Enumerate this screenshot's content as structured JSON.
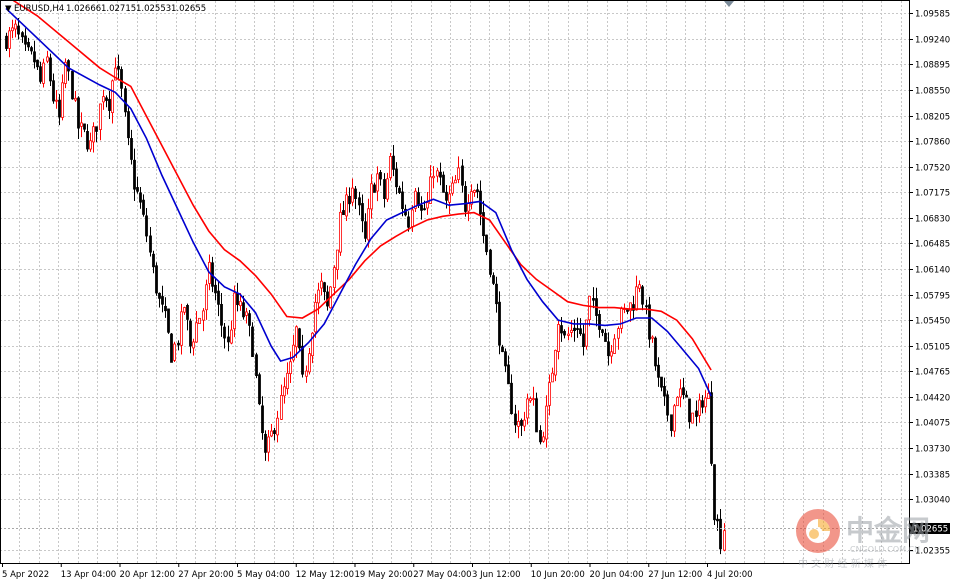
{
  "header": {
    "menu_glyph": "▼",
    "symbol": "EURUSD,H4",
    "open": "1.02666",
    "high": "1.02715",
    "low": "1.02553",
    "close": "1.02655"
  },
  "price_tag": "1.02655",
  "watermark": {
    "title": "中金网",
    "domain": "CNGOLD.COM.CN",
    "subtitle": "中 文 财 经 新 媒 体",
    "logo_colors": [
      "#e8412c",
      "#f7a21b"
    ]
  },
  "colors": {
    "bull": "#ff0000",
    "bear": "#000000",
    "ma_fast": "#0000d0",
    "ma_slow": "#ff0000",
    "grid": "#c8c8c8"
  },
  "chart_data": {
    "type": "candlestick",
    "symbol": "EURUSD",
    "timeframe": "H4",
    "y_ticks": [
      "1.09585",
      "1.09240",
      "1.08895",
      "1.08550",
      "1.08205",
      "1.07860",
      "1.07520",
      "1.07175",
      "1.06830",
      "1.06485",
      "1.06140",
      "1.05795",
      "1.05450",
      "1.05105",
      "1.04765",
      "1.04420",
      "1.04075",
      "1.03730",
      "1.03385",
      "1.03040",
      "1.02355"
    ],
    "x_ticks": [
      "5 Apr 2022",
      "13 Apr 04:00",
      "20 Apr 12:00",
      "27 Apr 20:00",
      "5 May 04:00",
      "12 May 12:00",
      "19 May 20:00",
      "27 May 04:00",
      "3 Jun 12:00",
      "10 Jun 20:00",
      "20 Jun 04:00",
      "27 Jun 12:00",
      "4 Jul 20:00"
    ],
    "ylim": [
      1.0218,
      1.0975
    ],
    "grid": true,
    "close_path": [
      [
        0,
        1.0925
      ],
      [
        3,
        1.0935
      ],
      [
        6,
        1.0905
      ],
      [
        9,
        1.0895
      ],
      [
        11,
        1.0865
      ],
      [
        13,
        1.0895
      ],
      [
        15,
        1.0845
      ],
      [
        17,
        1.0815
      ],
      [
        19,
        1.089
      ],
      [
        21,
        1.0855
      ],
      [
        23,
        1.0805
      ],
      [
        25,
        1.0795
      ],
      [
        27,
        1.078
      ],
      [
        29,
        1.081
      ],
      [
        31,
        1.0855
      ],
      [
        33,
        1.084
      ],
      [
        35,
        1.0895
      ],
      [
        37,
        1.085
      ],
      [
        39,
        1.078
      ],
      [
        41,
        1.073
      ],
      [
        43,
        1.07
      ],
      [
        45,
        1.066
      ],
      [
        47,
        1.061
      ],
      [
        49,
        1.057
      ],
      [
        51,
        1.0545
      ],
      [
        53,
        1.05
      ],
      [
        55,
        1.052
      ],
      [
        57,
        1.0565
      ],
      [
        59,
        1.051
      ],
      [
        61,
        1.054
      ],
      [
        63,
        1.056
      ],
      [
        65,
        1.061
      ],
      [
        67,
        1.058
      ],
      [
        69,
        1.054
      ],
      [
        71,
        1.051
      ],
      [
        73,
        1.057
      ],
      [
        75,
        1.056
      ],
      [
        77,
        1.0545
      ],
      [
        79,
        1.051
      ],
      [
        81,
        1.042
      ],
      [
        83,
        1.036
      ],
      [
        85,
        1.039
      ],
      [
        87,
        1.042
      ],
      [
        89,
        1.045
      ],
      [
        91,
        1.048
      ],
      [
        93,
        1.053
      ],
      [
        95,
        1.046
      ],
      [
        97,
        1.051
      ],
      [
        99,
        1.057
      ],
      [
        101,
        1.059
      ],
      [
        103,
        1.056
      ],
      [
        105,
        1.062
      ],
      [
        107,
        1.068
      ],
      [
        109,
        1.07
      ],
      [
        111,
        1.073
      ],
      [
        113,
        1.069
      ],
      [
        115,
        1.065
      ],
      [
        117,
        1.072
      ],
      [
        119,
        1.074
      ],
      [
        121,
        1.071
      ],
      [
        123,
        1.076
      ],
      [
        125,
        1.073
      ],
      [
        127,
        1.07
      ],
      [
        129,
        1.068
      ],
      [
        131,
        1.073
      ],
      [
        133,
        1.069
      ],
      [
        135,
        1.07
      ],
      [
        137,
        1.075
      ],
      [
        139,
        1.073
      ],
      [
        141,
        1.07
      ],
      [
        143,
        1.072
      ],
      [
        145,
        1.074
      ],
      [
        147,
        1.07
      ],
      [
        149,
        1.073
      ],
      [
        151,
        1.072
      ],
      [
        153,
        1.066
      ],
      [
        155,
        1.062
      ],
      [
        157,
        1.056
      ],
      [
        159,
        1.049
      ],
      [
        161,
        1.045
      ],
      [
        163,
        1.041
      ],
      [
        165,
        1.04
      ],
      [
        167,
        1.044
      ],
      [
        169,
        1.043
      ],
      [
        171,
        1.038
      ],
      [
        173,
        1.042
      ],
      [
        175,
        1.048
      ],
      [
        177,
        1.055
      ],
      [
        179,
        1.052
      ],
      [
        181,
        1.053
      ],
      [
        183,
        1.054
      ],
      [
        185,
        1.051
      ],
      [
        187,
        1.057
      ],
      [
        189,
        1.055
      ],
      [
        191,
        1.054
      ],
      [
        193,
        1.05
      ],
      [
        195,
        1.053
      ],
      [
        197,
        1.055
      ],
      [
        199,
        1.056
      ],
      [
        201,
        1.057
      ],
      [
        203,
        1.06
      ],
      [
        205,
        1.055
      ],
      [
        207,
        1.051
      ],
      [
        209,
        1.046
      ],
      [
        211,
        1.043
      ],
      [
        213,
        1.041
      ],
      [
        215,
        1.045
      ],
      [
        217,
        1.044
      ],
      [
        219,
        1.042
      ],
      [
        221,
        1.041
      ],
      [
        223,
        1.044
      ],
      [
        225,
        1.044
      ],
      [
        227,
        1.029
      ],
      [
        228,
        1.027
      ],
      [
        229,
        1.025
      ],
      [
        230,
        1.0266
      ]
    ],
    "ma_fast": [
      [
        0,
        1.0965
      ],
      [
        10,
        1.0925
      ],
      [
        20,
        1.0885
      ],
      [
        30,
        1.0862
      ],
      [
        35,
        1.0852
      ],
      [
        40,
        1.083
      ],
      [
        45,
        1.079
      ],
      [
        50,
        1.074
      ],
      [
        55,
        1.0695
      ],
      [
        60,
        1.065
      ],
      [
        65,
        1.061
      ],
      [
        70,
        1.059
      ],
      [
        75,
        1.058
      ],
      [
        80,
        1.0555
      ],
      [
        85,
        1.051
      ],
      [
        88,
        1.049
      ],
      [
        92,
        1.0495
      ],
      [
        97,
        1.0515
      ],
      [
        102,
        1.054
      ],
      [
        107,
        1.058
      ],
      [
        112,
        1.062
      ],
      [
        117,
        1.0655
      ],
      [
        122,
        1.068
      ],
      [
        127,
        1.069
      ],
      [
        132,
        1.07
      ],
      [
        137,
        1.0708
      ],
      [
        142,
        1.07
      ],
      [
        147,
        1.0702
      ],
      [
        152,
        1.0705
      ],
      [
        157,
        1.069
      ],
      [
        162,
        1.064
      ],
      [
        167,
        1.06
      ],
      [
        172,
        1.057
      ],
      [
        177,
        1.0545
      ],
      [
        182,
        1.054
      ],
      [
        187,
        1.054
      ],
      [
        192,
        1.0538
      ],
      [
        197,
        1.054
      ],
      [
        202,
        1.0548
      ],
      [
        207,
        1.0548
      ],
      [
        212,
        1.053
      ],
      [
        217,
        1.0505
      ],
      [
        222,
        1.048
      ],
      [
        226,
        1.0443
      ]
    ],
    "ma_slow": [
      [
        0,
        1.0982
      ],
      [
        10,
        1.0955
      ],
      [
        20,
        1.092
      ],
      [
        30,
        1.0885
      ],
      [
        35,
        1.0872
      ],
      [
        40,
        1.086
      ],
      [
        45,
        1.082
      ],
      [
        50,
        1.078
      ],
      [
        55,
        1.074
      ],
      [
        60,
        1.07
      ],
      [
        65,
        1.0665
      ],
      [
        70,
        1.064
      ],
      [
        75,
        1.0625
      ],
      [
        80,
        1.0605
      ],
      [
        85,
        1.058
      ],
      [
        90,
        1.055
      ],
      [
        95,
        1.0548
      ],
      [
        100,
        1.056
      ],
      [
        105,
        1.058
      ],
      [
        110,
        1.06
      ],
      [
        115,
        1.0625
      ],
      [
        120,
        1.0645
      ],
      [
        125,
        1.0658
      ],
      [
        130,
        1.067
      ],
      [
        135,
        1.068
      ],
      [
        140,
        1.0685
      ],
      [
        145,
        1.0688
      ],
      [
        150,
        1.069
      ],
      [
        155,
        1.068
      ],
      [
        160,
        1.065
      ],
      [
        165,
        1.062
      ],
      [
        170,
        1.06
      ],
      [
        175,
        1.0585
      ],
      [
        180,
        1.057
      ],
      [
        185,
        1.0565
      ],
      [
        190,
        1.0562
      ],
      [
        195,
        1.0562
      ],
      [
        200,
        1.056
      ],
      [
        205,
        1.056
      ],
      [
        210,
        1.0557
      ],
      [
        215,
        1.0545
      ],
      [
        220,
        1.052
      ],
      [
        226,
        1.0478
      ]
    ]
  }
}
